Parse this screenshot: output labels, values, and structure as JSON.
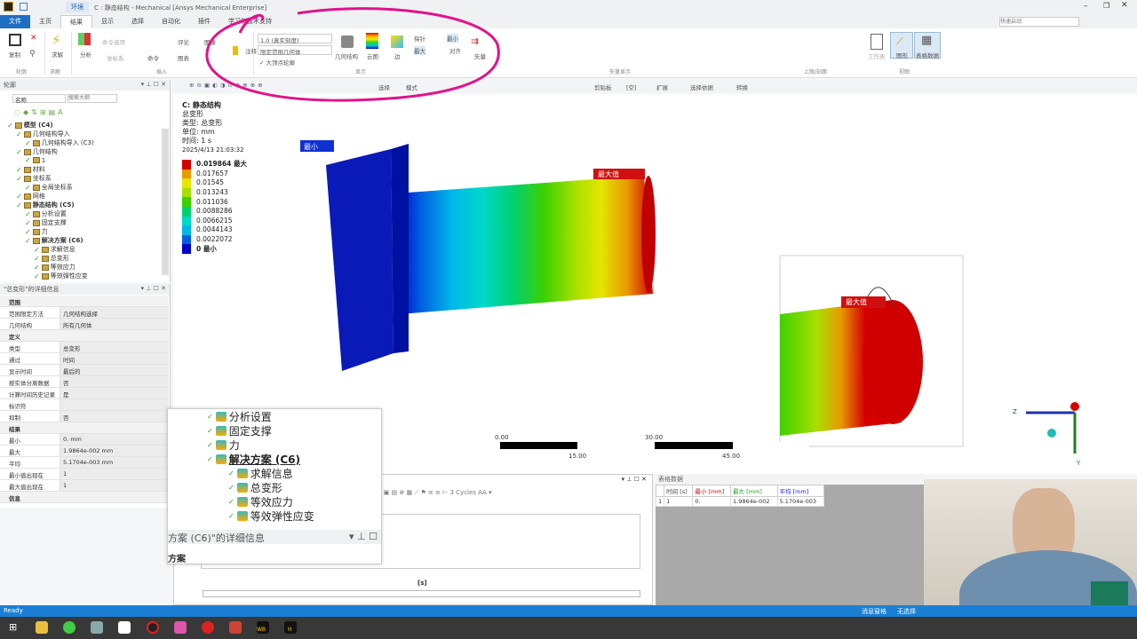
{
  "window": {
    "title": "C : 静态结构 - Mechanical [Ansys Mechanical Enterprise]",
    "context_tab": "环境",
    "search_placeholder": "快速启动"
  },
  "tabs": [
    "文件",
    "主页",
    "结果",
    "显示",
    "选择",
    "自动化",
    "插件",
    "学习和技术支持"
  ],
  "active_tab": "结果",
  "ribbon": {
    "groups": [
      "轮廓",
      "求解",
      "插入",
      "显示",
      "矢量显示",
      "上限/剖面",
      "视图"
    ],
    "buttons": {
      "copy": "复制",
      "solve": "求解",
      "analysis": "分析",
      "probe_stack": "命令选项",
      "comment": "评论",
      "image": "图像",
      "coord": "坐标系",
      "command": "命令",
      "chart": "图表",
      "annotation": "注释",
      "geometry": "几何结构",
      "contour": "云图",
      "edge": "边",
      "probe": "探针",
      "min": "最小",
      "max": "最大",
      "align": "对齐",
      "vector": "矢量",
      "worksheet": "工作表",
      "graph": "图形",
      "tabular": "表格数据"
    },
    "scale_select": "1.0 (真实刻度)",
    "geometry_select": "限定范围几何体",
    "max_contour_check": "大顶点轮廓"
  },
  "toolbar": {
    "select": "选择",
    "mode": "模式",
    "clipboard": "剪贴板",
    "empty": "[空]",
    "extend": "扩展",
    "select_by": "选择依据",
    "convert": "转换"
  },
  "outline": {
    "title": "轮廓",
    "name_filter": "名称",
    "search_placeholder": "搜索大纲",
    "items": [
      {
        "label": "模型 (C4)",
        "bold": true,
        "level": 0
      },
      {
        "label": "几何结构导入",
        "level": 1
      },
      {
        "label": "几何结构导入 (C3)",
        "level": 2
      },
      {
        "label": "几何结构",
        "level": 1
      },
      {
        "label": "1",
        "level": 2
      },
      {
        "label": "材料",
        "level": 1
      },
      {
        "label": "坐标系",
        "level": 1
      },
      {
        "label": "全局坐标系",
        "level": 2
      },
      {
        "label": "网格",
        "level": 1
      },
      {
        "label": "静态结构 (C5)",
        "bold": true,
        "level": 1
      },
      {
        "label": "分析设置",
        "level": 2
      },
      {
        "label": "固定支撑",
        "level": 2
      },
      {
        "label": "力",
        "level": 2
      },
      {
        "label": "解决方案 (C6)",
        "bold": true,
        "level": 2
      },
      {
        "label": "求解信息",
        "level": 3
      },
      {
        "label": "总变形",
        "level": 3
      },
      {
        "label": "等效应力",
        "level": 3
      },
      {
        "label": "等效弹性应变",
        "level": 3
      }
    ]
  },
  "details": {
    "title": "\"总变形\"的详细信息",
    "rows": [
      {
        "section": "范围"
      },
      {
        "k": "范围限定方法",
        "v": "几何结构选择"
      },
      {
        "k": "几何结构",
        "v": "所有几何体"
      },
      {
        "section": "定义"
      },
      {
        "k": "类型",
        "v": "总变形"
      },
      {
        "k": "通过",
        "v": "时间"
      },
      {
        "k": "显示时间",
        "v": "最后的"
      },
      {
        "k": "按实体分离数据",
        "v": "否"
      },
      {
        "k": "计算时间历史记录",
        "v": "是"
      },
      {
        "k": "标识符",
        "v": ""
      },
      {
        "k": "抑制",
        "v": "否"
      },
      {
        "section": "结果"
      },
      {
        "k": "最小",
        "v": "0. mm"
      },
      {
        "k": "最大",
        "v": "1.9864e-002 mm"
      },
      {
        "k": "平均",
        "v": "5.1704e-003 mm"
      },
      {
        "k": "最小值出现在",
        "v": "1"
      },
      {
        "k": "最大值出现在",
        "v": "1"
      },
      {
        "section": "信息"
      }
    ]
  },
  "viewport": {
    "header": [
      "C: 静态结构",
      "总变形",
      "类型: 总变形",
      "单位: mm",
      "时间: 1 s",
      "2025/4/13 21:03:32"
    ],
    "legend": [
      {
        "value": "0.019864 最大",
        "color": "#d40000"
      },
      {
        "value": "0.017657",
        "color": "#e89a00"
      },
      {
        "value": "0.01545",
        "color": "#e5e500"
      },
      {
        "value": "0.013243",
        "color": "#a8e000"
      },
      {
        "value": "0.011036",
        "color": "#3fd000"
      },
      {
        "value": "0.0088286",
        "color": "#00d070"
      },
      {
        "value": "0.0066215",
        "color": "#00d8c8"
      },
      {
        "value": "0.0044143",
        "color": "#00b8e8"
      },
      {
        "value": "0.0022072",
        "color": "#0060e0"
      },
      {
        "value": "0 最小",
        "color": "#0000c8"
      }
    ],
    "min_tag": "最小",
    "max_tag": "最大值",
    "scale": [
      "0.00",
      "15.00",
      "30.00",
      "45.00"
    ],
    "axes": {
      "z": "Z",
      "y": "Y"
    }
  },
  "floating_tree": {
    "items": [
      "分析设置",
      "固定支撑",
      "力",
      "解决方案 (C6)",
      "求解信息",
      "总变形",
      "等效应力",
      "等效弹性应变"
    ],
    "details_title": "方案 (C6)\"的详细信息",
    "details_row": "方案"
  },
  "graph": {
    "cycles": "3 Cycles",
    "xlabel": "[s]"
  },
  "table": {
    "title": "表格数据",
    "headers": [
      "时间 [s]",
      "最小 [mm]",
      "最大 [mm]",
      "平均 [mm]"
    ],
    "rows": [
      [
        "1",
        "1",
        "0.",
        "1.9864e-002",
        "5.1704e-003"
      ]
    ],
    "colors": {
      "min": "#d00000",
      "max": "#20a020",
      "avg": "#2020d0"
    }
  },
  "status": {
    "ready": "Ready",
    "messages": "消息窗格",
    "selection": "无选择"
  },
  "taskbar": {
    "labels": [
      "WB",
      "H"
    ]
  }
}
